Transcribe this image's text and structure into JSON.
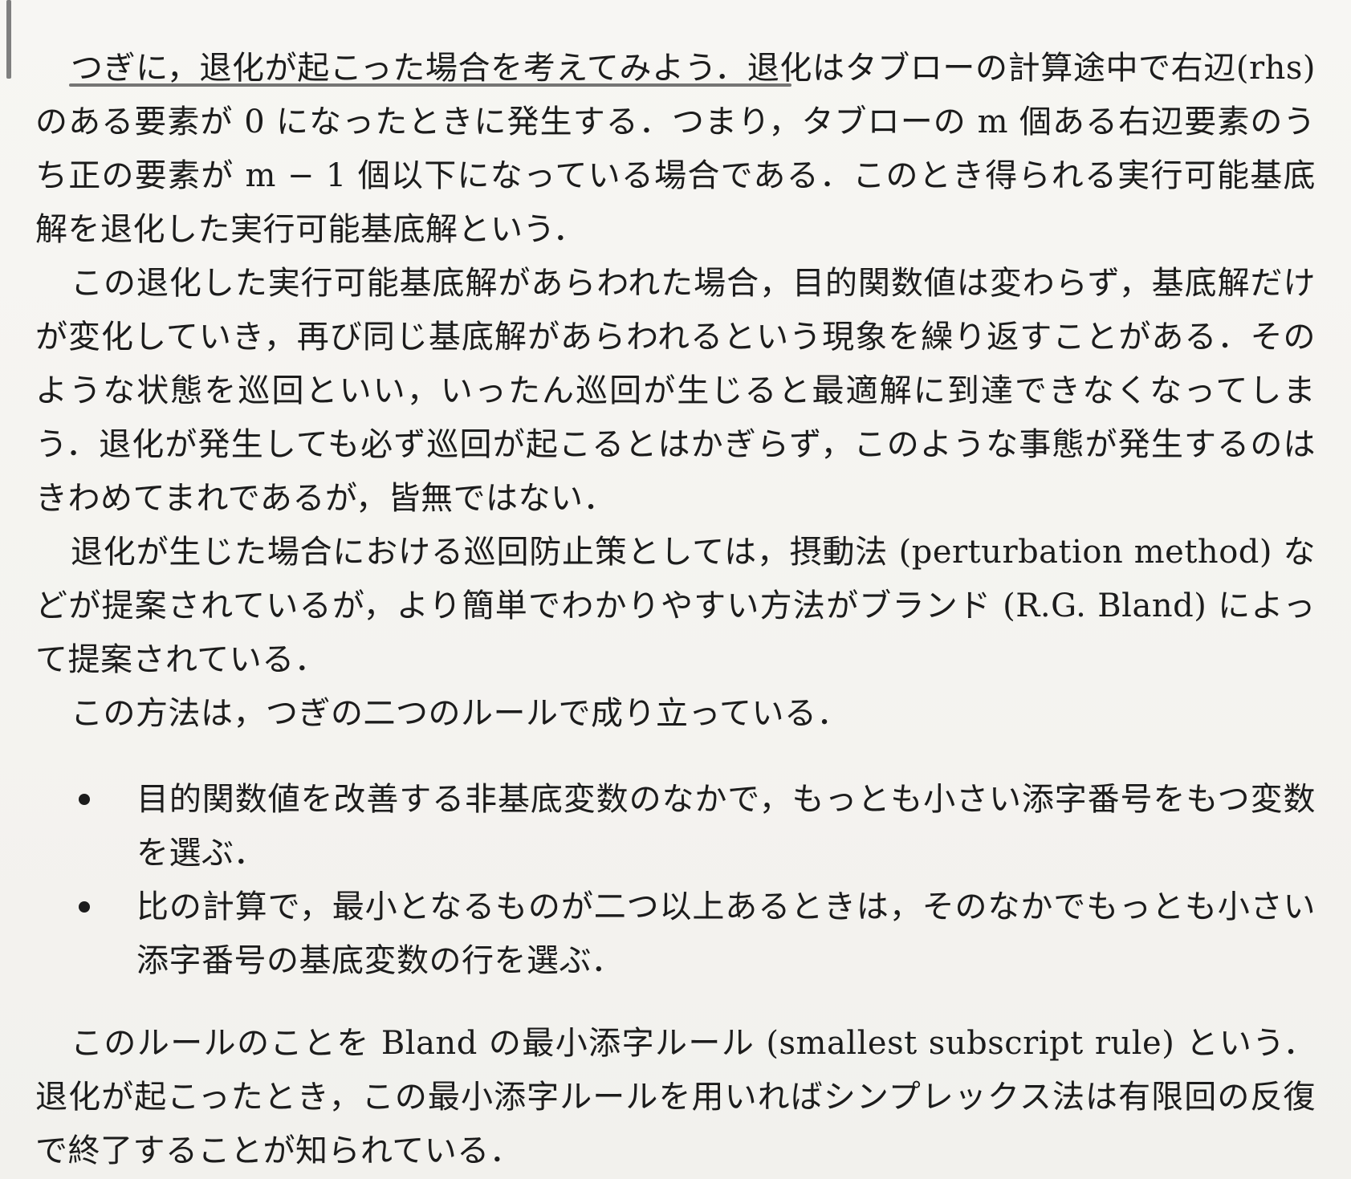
{
  "document": {
    "paragraphs": [
      "つぎに，退化が起こった場合を考えてみよう．退化はタブローの計算途中で右辺(rhs) のある要素が 0 になったときに発生する．つまり，タブローの m 個ある右辺要素のうち正の要素が m − 1 個以下になっている場合である．このとき得られる実行可能基底解を退化した実行可能基底解という．",
      "この退化した実行可能基底解があらわれた場合，目的関数値は変わらず，基底解だけが変化していき，再び同じ基底解があらわれるという現象を繰り返すことがある．そのような状態を巡回といい，いったん巡回が生じると最適解に到達できなくなってしまう．退化が発生しても必ず巡回が起こるとはかぎらず，このような事態が発生するのはきわめてまれであるが，皆無ではない．",
      "退化が生じた場合における巡回防止策としては，摂動法 (perturbation method) などが提案されているが，より簡単でわかりやすい方法がブランド (R.G. Bland) によって提案されている．",
      "この方法は，つぎの二つのルールで成り立っている．"
    ],
    "rules": [
      "目的関数値を改善する非基底変数のなかで，もっとも小さい添字番号をもつ変数を選ぶ．",
      "比の計算で，最小となるものが二つ以上あるときは，そのなかでもっとも小さい添字番号の基底変数の行を選ぶ．"
    ],
    "closing": "このルールのことを Bland の最小添字ルール (smallest subscript rule) という．退化が起こったとき，この最小添字ルールを用いればシンプレックス法は有限回の反復で終了することが知られている．"
  }
}
